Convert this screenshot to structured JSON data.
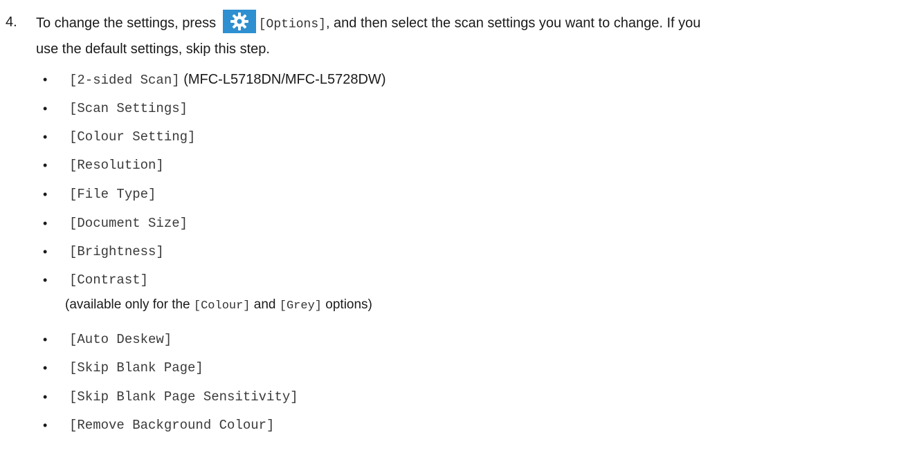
{
  "step": {
    "number": "4.",
    "text_before_icon": "To change the settings, press ",
    "options_label": "[Options]",
    "text_after_icon": ", and then select the scan settings you want to change. If you",
    "text_line2": "use the default settings, skip this step.",
    "icon": "gear-icon",
    "icon_color": "#2e8fd1"
  },
  "settings": [
    {
      "label": "[2-sided Scan]",
      "note": " (MFC-L5718DN/MFC-L5728DW)"
    },
    {
      "label": "[Scan Settings]",
      "note": ""
    },
    {
      "label": "[Colour Setting]",
      "note": ""
    },
    {
      "label": "[Resolution]",
      "note": ""
    },
    {
      "label": "[File Type]",
      "note": ""
    },
    {
      "label": "[Document Size]",
      "note": ""
    },
    {
      "label": "[Brightness]",
      "note": ""
    },
    {
      "label": "[Contrast]",
      "note": ""
    },
    {
      "label": "[Auto Deskew]",
      "note": ""
    },
    {
      "label": "[Skip Blank Page]",
      "note": ""
    },
    {
      "label": "[Skip Blank Page Sensitivity]",
      "note": ""
    },
    {
      "label": "[Remove Background Colour]",
      "note": ""
    }
  ],
  "bullet": "•",
  "contrast_note": {
    "prefix": "(available only for the ",
    "colour": "[Colour]",
    "middle": " and ",
    "grey": "[Grey]",
    "suffix": " options)"
  }
}
